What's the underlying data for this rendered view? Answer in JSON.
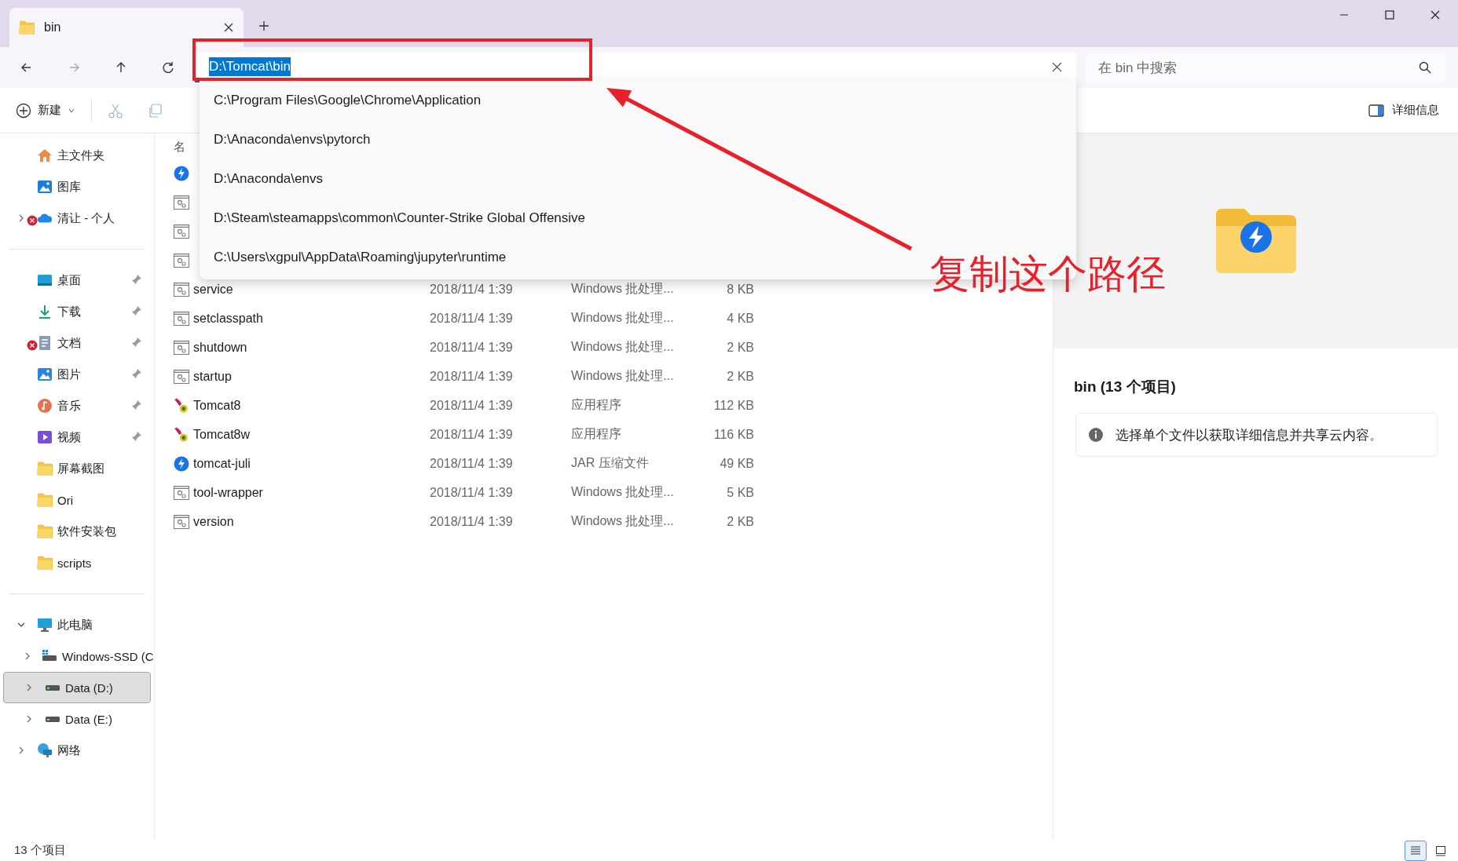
{
  "window": {
    "tab_title": "bin"
  },
  "nav_buttons": [
    {
      "kind": "back",
      "disabled": false
    },
    {
      "kind": "forward",
      "disabled": true
    },
    {
      "kind": "up",
      "disabled": false
    },
    {
      "kind": "refresh",
      "disabled": false
    }
  ],
  "address": {
    "value": "D:\\Tomcat\\bin",
    "suggestions": [
      "C:\\Program Files\\Google\\Chrome\\Application",
      "D:\\Anaconda\\envs\\pytorch",
      "D:\\Anaconda\\envs",
      "D:\\Steam\\steamapps\\common\\Counter-Strike Global Offensive",
      "C:\\Users\\xgpul\\AppData\\Roaming\\jupyter\\runtime"
    ]
  },
  "search": {
    "placeholder": "在 bin 中搜索"
  },
  "commands": [
    {
      "kind": "new",
      "label": "新建",
      "disabled": false
    },
    {
      "kind": "cut",
      "disabled": true
    },
    {
      "kind": "copy",
      "disabled": true
    }
  ],
  "details_toggle": {
    "label": "详细信息"
  },
  "sidebar": {
    "groups": [
      {
        "items": [
          {
            "label": "主文件夹",
            "kind": "home",
            "pinned": false,
            "sync_error": false,
            "selected": false
          },
          {
            "label": "图库",
            "kind": "gallery",
            "pinned": false,
            "sync_error": false,
            "selected": false
          },
          {
            "label": "清让 - 个人",
            "kind": "cloud",
            "pinned": false,
            "sync_error": true,
            "selected": false,
            "expanded": false
          }
        ]
      },
      {
        "items": [
          {
            "label": "桌面",
            "kind": "desktop",
            "pinned": true,
            "sync_error": false,
            "selected": false
          },
          {
            "label": "下载",
            "kind": "download",
            "pinned": true,
            "sync_error": false,
            "selected": false
          },
          {
            "label": "文档",
            "kind": "documents",
            "pinned": true,
            "sync_error": true,
            "selected": false
          },
          {
            "label": "图片",
            "kind": "pictures",
            "pinned": true,
            "sync_error": false,
            "selected": false
          },
          {
            "label": "音乐",
            "kind": "music",
            "pinned": true,
            "sync_error": false,
            "selected": false
          },
          {
            "label": "视频",
            "kind": "videos",
            "pinned": true,
            "sync_error": false,
            "selected": false
          },
          {
            "label": "屏幕截图",
            "kind": "folder",
            "pinned": false,
            "sync_error": false,
            "selected": false
          },
          {
            "label": "Ori",
            "kind": "folder",
            "pinned": false,
            "sync_error": false,
            "selected": false
          },
          {
            "label": "软件安装包",
            "kind": "folder",
            "pinned": false,
            "sync_error": false,
            "selected": false
          },
          {
            "label": "scripts",
            "kind": "folder",
            "pinned": false,
            "sync_error": false,
            "selected": false
          }
        ]
      },
      {
        "items": [
          {
            "label": "此电脑",
            "kind": "pc",
            "pinned": false,
            "sync_error": false,
            "selected": false,
            "expanded": true,
            "children": [
              {
                "label": "Windows-SSD (C",
                "kind": "system-drive",
                "pinned": false,
                "sync_error": false,
                "selected": false,
                "expanded": false
              },
              {
                "label": "Data (D:)",
                "kind": "drive",
                "pinned": false,
                "sync_error": false,
                "selected": true,
                "expanded": false
              },
              {
                "label": "Data (E:)",
                "kind": "drive",
                "pinned": false,
                "sync_error": false,
                "selected": false,
                "expanded": false
              }
            ]
          },
          {
            "label": "网络",
            "kind": "network",
            "pinned": false,
            "sync_error": false,
            "selected": false,
            "expanded": false
          }
        ]
      }
    ]
  },
  "file_list": {
    "column_header": "名",
    "rows": [
      {
        "kind": "jar"
      },
      {
        "kind": "batch"
      },
      {
        "kind": "batch"
      },
      {
        "kind": "batch"
      },
      {
        "kind": "batch",
        "name": "service",
        "date": "2018/11/4 1:39",
        "type": "Windows 批处理...",
        "size": "8 KB"
      },
      {
        "kind": "batch",
        "name": "setclasspath",
        "date": "2018/11/4 1:39",
        "type": "Windows 批处理...",
        "size": "4 KB"
      },
      {
        "kind": "batch",
        "name": "shutdown",
        "date": "2018/11/4 1:39",
        "type": "Windows 批处理...",
        "size": "2 KB"
      },
      {
        "kind": "batch",
        "name": "startup",
        "date": "2018/11/4 1:39",
        "type": "Windows 批处理...",
        "size": "2 KB"
      },
      {
        "kind": "app",
        "name": "Tomcat8",
        "date": "2018/11/4 1:39",
        "type": "应用程序",
        "size": "112 KB"
      },
      {
        "kind": "app",
        "name": "Tomcat8w",
        "date": "2018/11/4 1:39",
        "type": "应用程序",
        "size": "116 KB"
      },
      {
        "kind": "jar",
        "name": "tomcat-juli",
        "date": "2018/11/4 1:39",
        "type": "JAR 压缩文件",
        "size": "49 KB"
      },
      {
        "kind": "batch",
        "name": "tool-wrapper",
        "date": "2018/11/4 1:39",
        "type": "Windows 批处理...",
        "size": "5 KB"
      },
      {
        "kind": "batch",
        "name": "version",
        "date": "2018/11/4 1:39",
        "type": "Windows 批处理...",
        "size": "2 KB"
      }
    ]
  },
  "details": {
    "title": "bin (13 个项目)",
    "info": "选择单个文件以获取详细信息并共享云内容。"
  },
  "status_bar": {
    "count": "13 个项目",
    "views": [
      {
        "kind": "details",
        "selected": true
      },
      {
        "kind": "tiles",
        "selected": false
      }
    ]
  },
  "annotation": {
    "callout": "复制这个路径"
  }
}
